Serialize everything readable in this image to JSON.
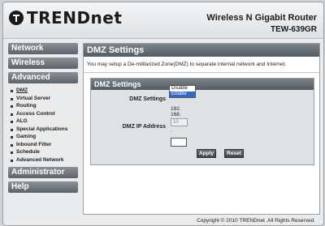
{
  "header": {
    "brand": "TRENDnet",
    "product": "Wireless N Gigabit Router",
    "model": "TEW-639GR"
  },
  "sidebar": {
    "network": "Network",
    "wireless": "Wireless",
    "advanced": "Advanced",
    "advanced_items": [
      "DMZ",
      "Virtual Server",
      "Routing",
      "Access Control",
      "ALG",
      "Special Applications",
      "Gaming",
      "Inbound Filter",
      "Schedule",
      "Advanced Network"
    ],
    "administrator": "Administrator",
    "help": "Help"
  },
  "main": {
    "title": "DMZ Settings",
    "description": "You may setup a De-militarized Zone(DMZ) to separate internal network and Internet.",
    "box_title": "DMZ Settings",
    "dmz_settings_label": "DMZ Settings",
    "dmz_ip_label": "DMZ IP Address",
    "ip_parts": [
      "192.",
      "168.",
      "10",
      "."
    ],
    "dropdown_options": [
      "Disable",
      "Enable"
    ],
    "dropdown_selected": "Enable",
    "apply_label": "Apply",
    "reset_label": "Reset"
  },
  "footer": {
    "copyright": "Copyright © 2010 TRENDnet. All Rights Reserved."
  }
}
